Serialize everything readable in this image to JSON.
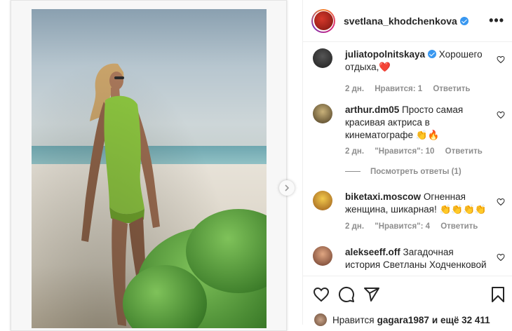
{
  "post": {
    "username": "svetlana_khodchenkova",
    "verified": true,
    "more_label": "•••"
  },
  "comments": [
    {
      "username": "juliatopolnitskaya",
      "verified": true,
      "text": "Хорошего отдыха,❤️",
      "time": "2 дн.",
      "likes": "Нравится: 1",
      "reply": "Ответить",
      "avatar_color": "#2b2b2b"
    },
    {
      "username": "arthur.dm05",
      "verified": false,
      "text": "Просто самая красивая актриса в кинематографе 👏🔥",
      "time": "2 дн.",
      "likes": "\"Нравится\": 10",
      "reply": "Ответить",
      "view_replies": "Посмотреть ответы (1)",
      "avatar_color": "#7a6a4a"
    },
    {
      "username": "biketaxi.moscow",
      "verified": false,
      "text": "Огненная женщина, шикарная! 👏👏👏👏",
      "time": "2 дн.",
      "likes": "\"Нравится\": 4",
      "reply": "Ответить",
      "avatar_color": "#e1a02a"
    },
    {
      "username": "alekseeff.off",
      "verified": false,
      "text": "Загадочная история Светланы Ходченковой",
      "avatar_color": "#b5745a"
    }
  ],
  "likes_bar": {
    "prefix": "Нравится",
    "user": "gagara1987",
    "suffix": "и ещё 32 411"
  },
  "icons": {
    "like": "heart-icon",
    "comment": "comment-icon",
    "share": "share-icon",
    "save": "bookmark-icon",
    "next": "chevron-right-icon"
  }
}
